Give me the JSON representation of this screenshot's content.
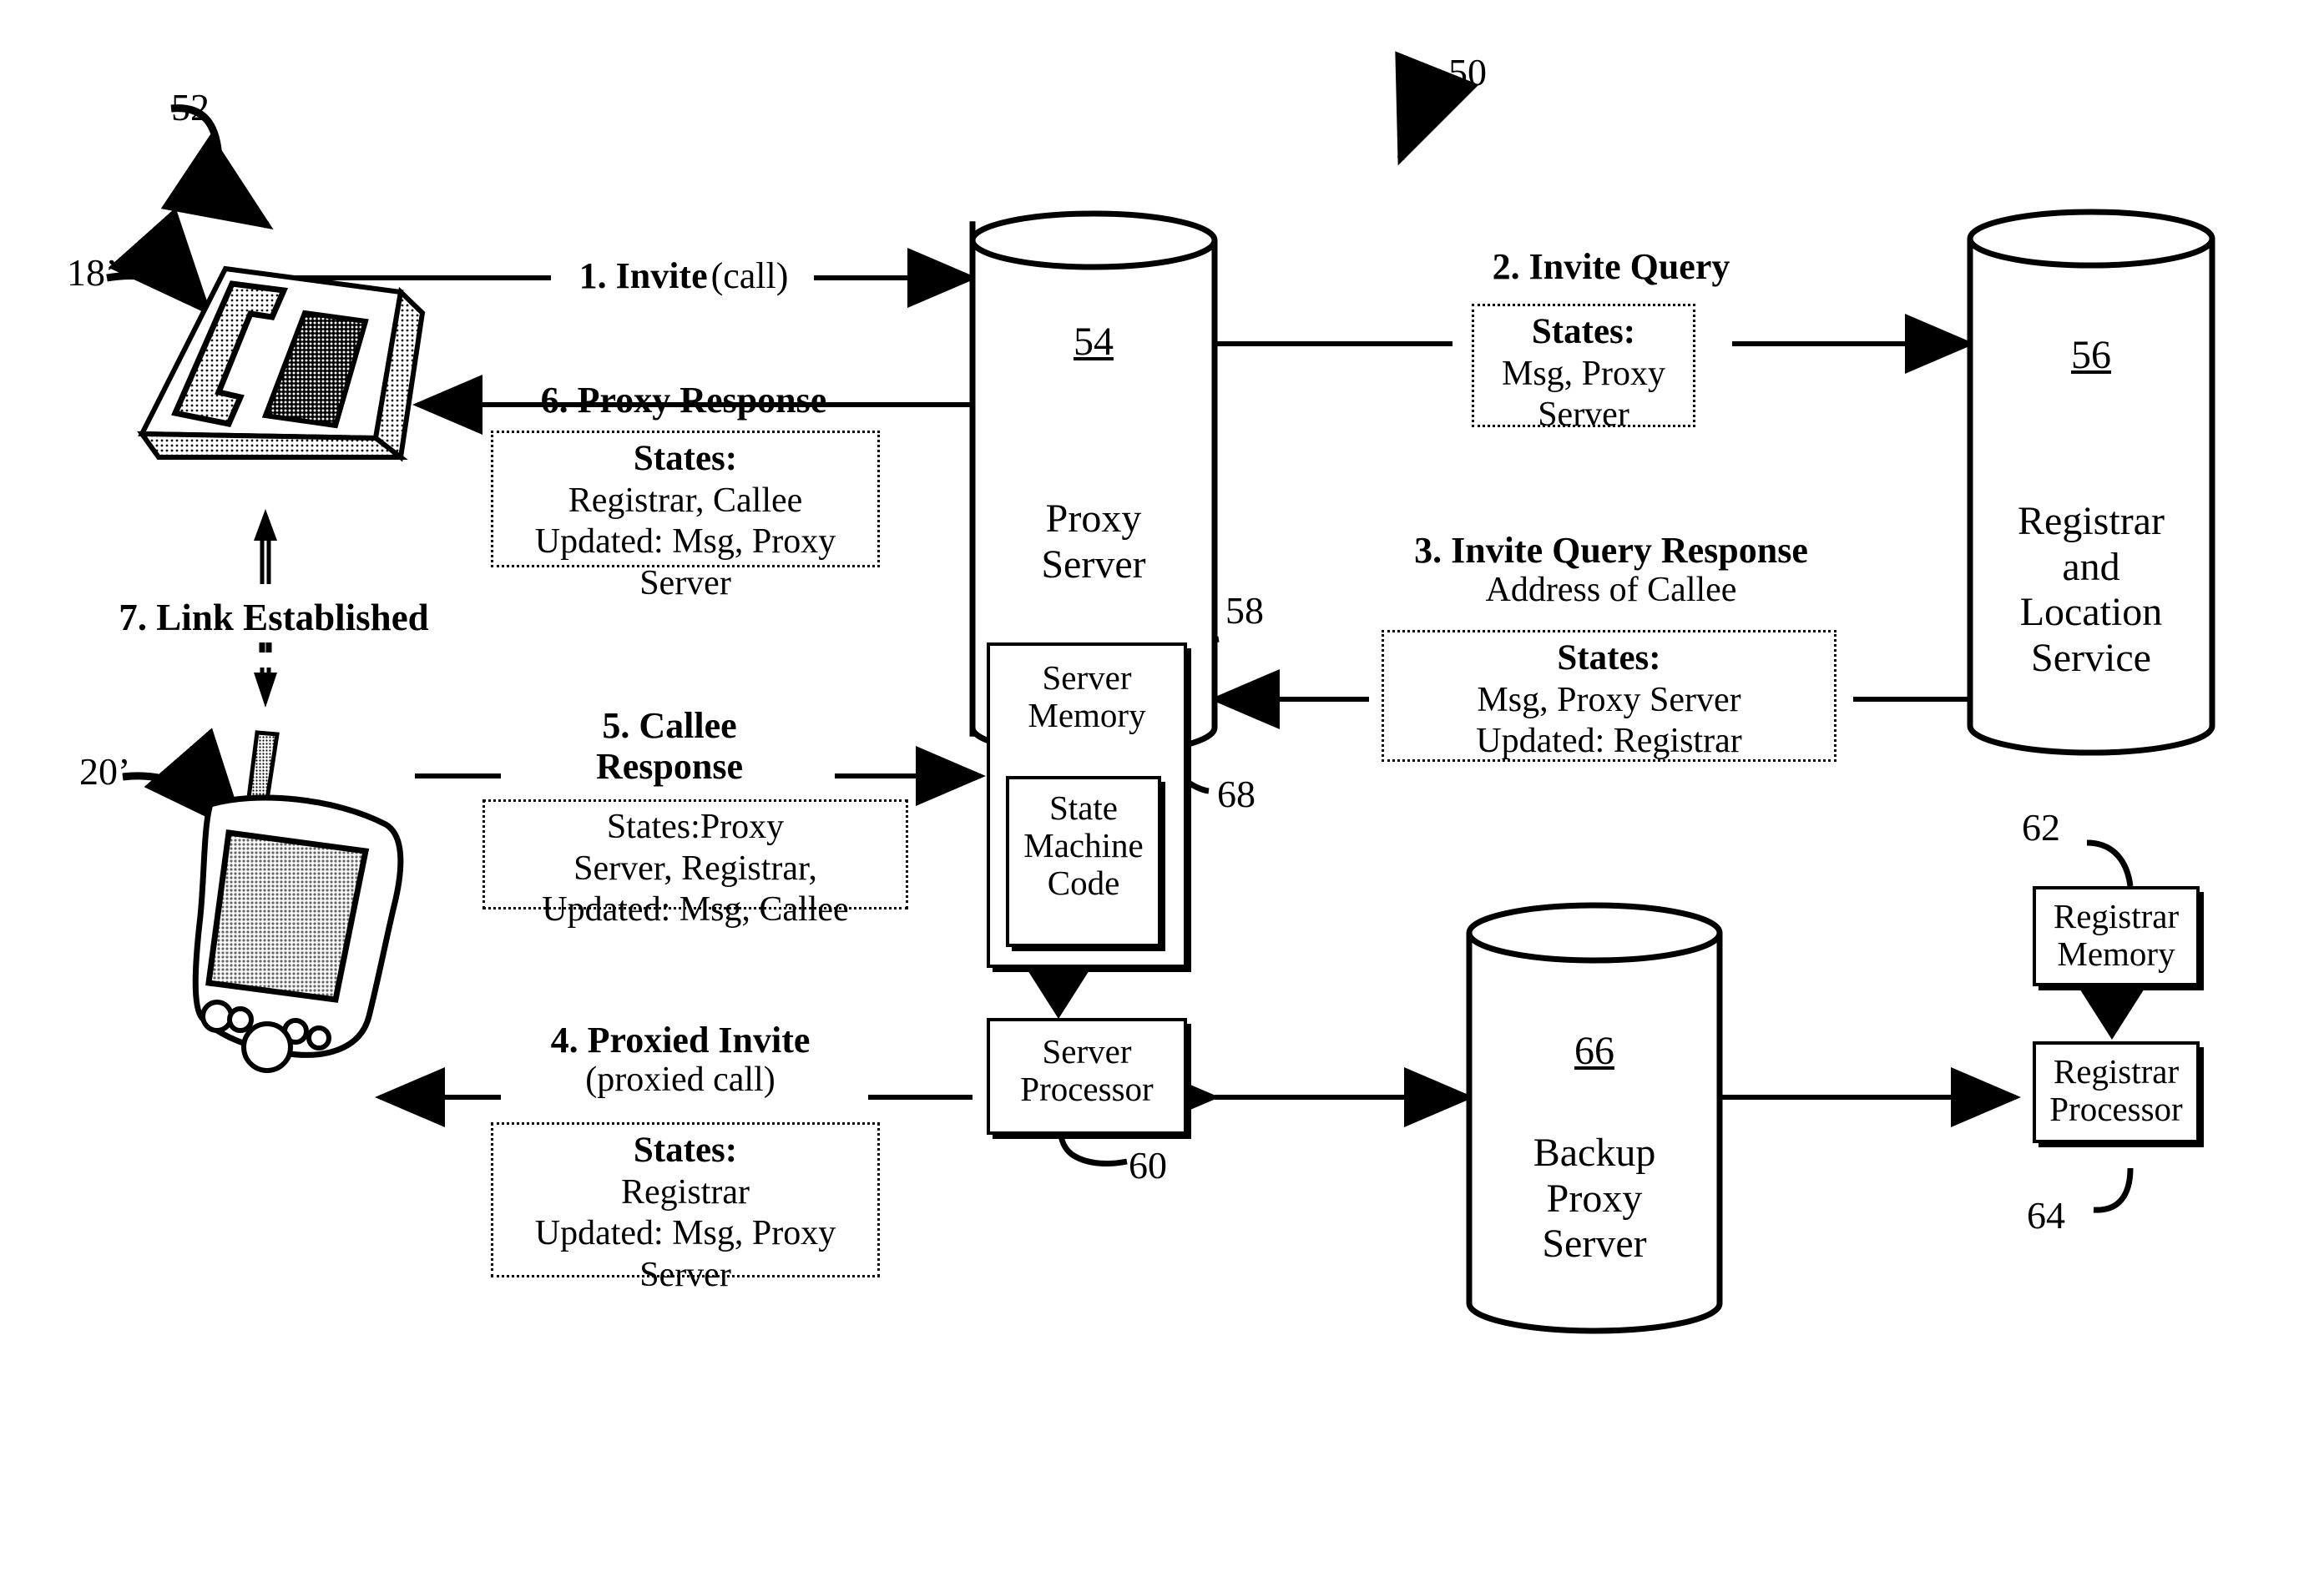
{
  "figure": {
    "ref_50": "50",
    "ref_52": "52",
    "ref_18p": "18’",
    "ref_20p": "20’"
  },
  "devices": {
    "desk_phone": {
      "icon": "desk-phone-icon",
      "ref": "18’"
    },
    "pda": {
      "icon": "pda-handheld-icon",
      "ref": "20’"
    }
  },
  "nodes": {
    "proxy_server": {
      "ref": "54",
      "title_line1": "Proxy",
      "title_line2": "Server",
      "server_memory": {
        "label_line1": "Server",
        "label_line2": "Memory",
        "ref": "58"
      },
      "state_machine": {
        "label_line1": "State",
        "label_line2": "Machine",
        "label_line3": "Code",
        "ref": "68"
      },
      "server_processor": {
        "label_line1": "Server",
        "label_line2": "Processor",
        "ref": "60"
      }
    },
    "registrar": {
      "ref": "56",
      "title_line1": "Registrar",
      "title_line2": "and",
      "title_line3": "Location",
      "title_line4": "Service",
      "registrar_memory": {
        "label_line1": "Registrar",
        "label_line2": "Memory",
        "ref": "62"
      },
      "registrar_processor": {
        "label_line1": "Registrar",
        "label_line2": "Processor",
        "ref": "64"
      }
    },
    "backup_proxy": {
      "ref": "66",
      "title_line1": "Backup",
      "title_line2": "Proxy",
      "title_line3": "Server"
    }
  },
  "messages": {
    "m1": {
      "label_bold": "1. Invite",
      "label_reg": "(call)"
    },
    "m2": {
      "label_bold": "2. Invite Query",
      "states": {
        "header": "States:",
        "line1": "Msg, Proxy",
        "line2": "Server"
      }
    },
    "m3": {
      "label_bold": "3. Invite Query Response",
      "label_reg": "Address of Callee",
      "states": {
        "header": "States:",
        "line1": "Msg, Proxy Server",
        "line2": "Updated: Registrar"
      }
    },
    "m4": {
      "label_bold": "4. Proxied Invite",
      "label_reg": "(proxied call)",
      "states": {
        "header": "States:",
        "line1": "Registrar",
        "line2": "Updated: Msg, Proxy",
        "line3": "Server"
      }
    },
    "m5": {
      "label_bold_l1": "5. Callee",
      "label_bold_l2": "Response",
      "states": {
        "header": "States:Proxy",
        "line1": "Server, Registrar,",
        "line2": "Updated: Msg, Callee"
      }
    },
    "m6": {
      "label_bold": "6. Proxy Response",
      "states": {
        "header": "States:",
        "line1": "Registrar, Callee",
        "line2": "Updated: Msg, Proxy",
        "line3": "Server"
      }
    },
    "m7": {
      "label_bold": "7. Link Established"
    }
  },
  "colors": {
    "ink": "#000000",
    "paper": "#ffffff"
  }
}
